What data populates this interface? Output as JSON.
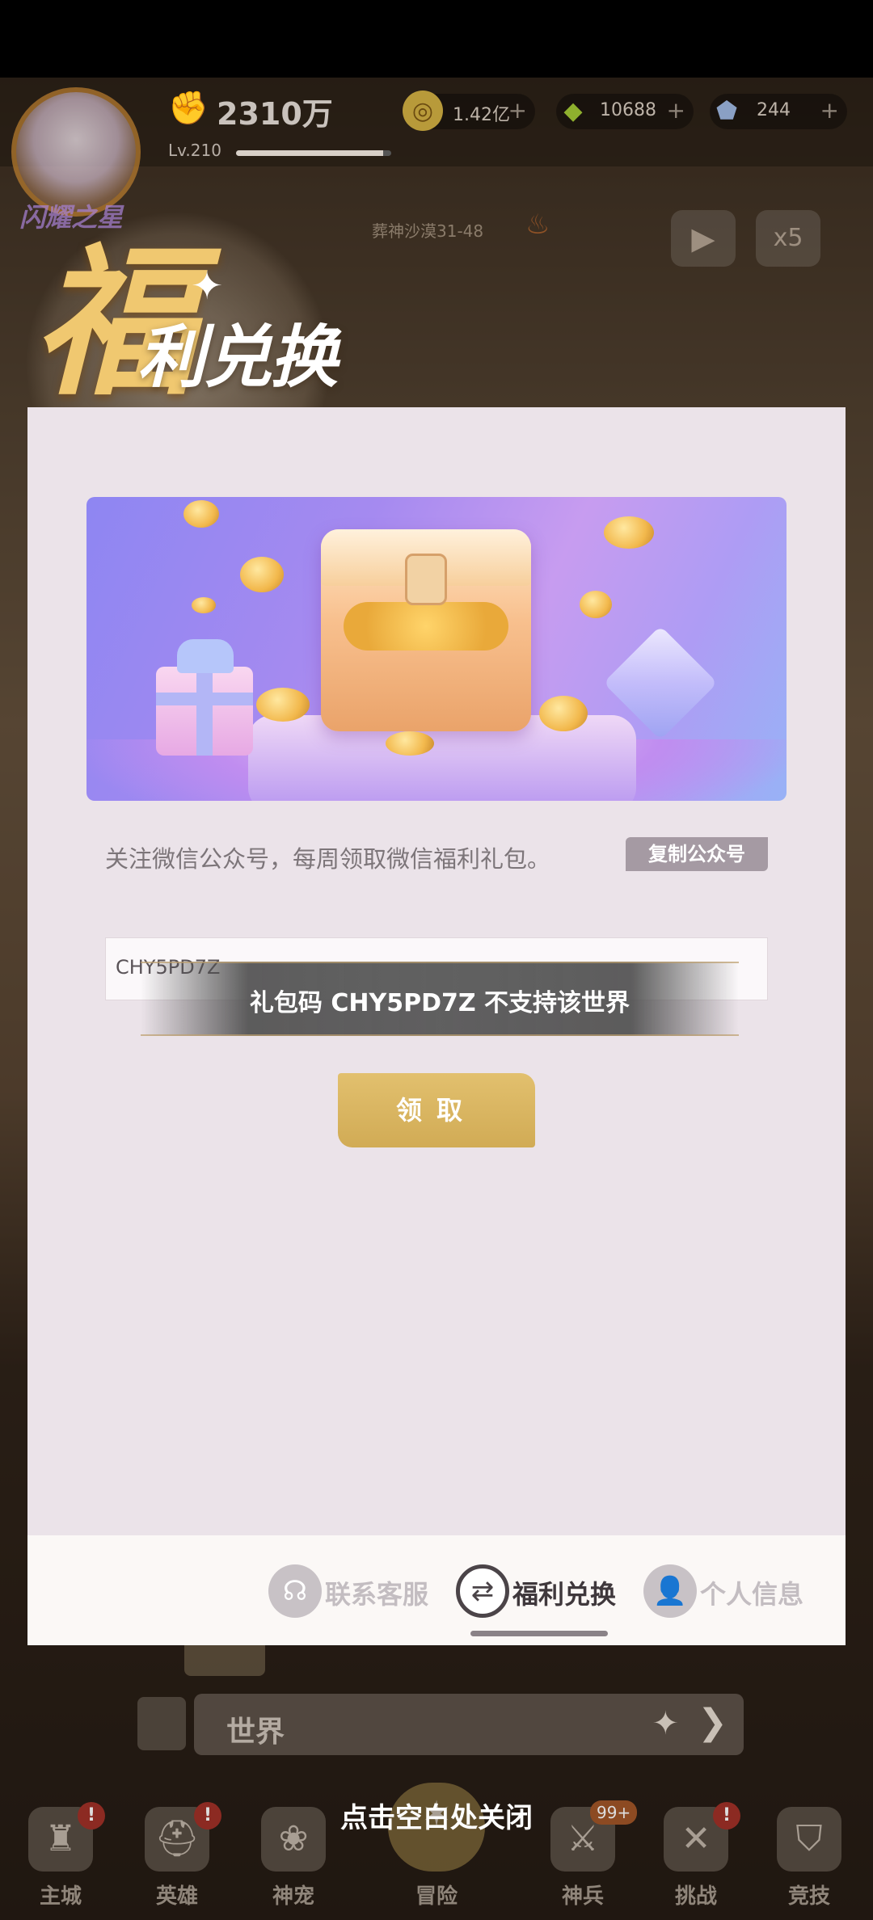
{
  "hud": {
    "power": "2310万",
    "level": "Lv.210",
    "level_progress": 0.95,
    "avatar_title": "闪耀之星",
    "resources": [
      {
        "icon": "gold-coin-icon",
        "value": "1.42亿",
        "plus": "+"
      },
      {
        "icon": "green-gem-icon",
        "value": "10688",
        "plus": "+"
      },
      {
        "icon": "blue-crystal-icon",
        "value": "244",
        "plus": "+"
      }
    ],
    "stage": "葬神沙漠31-48",
    "speed": "x5"
  },
  "header": {
    "title_big": "福",
    "title_rest": "利兑换"
  },
  "modal": {
    "follow_text": "关注微信公众号，每周领取微信福利礼包。",
    "copy_button": "复制公众号",
    "code_value": "CHY5PD7Z",
    "toast": "礼包码 CHY5PD7Z 不支持该世界",
    "claim_button": "领取",
    "tabs": [
      {
        "label": "联系客服",
        "icon": "headset-icon",
        "active": false
      },
      {
        "label": "福利兑换",
        "icon": "exchange-icon",
        "active": true
      },
      {
        "label": "个人信息",
        "icon": "person-icon",
        "active": false
      }
    ]
  },
  "chat": {
    "channel": "世界"
  },
  "close_hint": "点击空白处关闭",
  "bottom_nav": [
    {
      "label": "主城",
      "badge": "!"
    },
    {
      "label": "英雄",
      "badge": "!"
    },
    {
      "label": "神宠",
      "badge": ""
    },
    {
      "label": "冒险",
      "badge": ""
    },
    {
      "label": "神兵",
      "badge": "99+"
    },
    {
      "label": "挑战",
      "badge": "!"
    },
    {
      "label": "竞技",
      "badge": ""
    }
  ],
  "colors": {
    "accent_gold": "#d1ab55",
    "modal_bg": "#ebe3e9",
    "title_gold": "#f0c870"
  }
}
